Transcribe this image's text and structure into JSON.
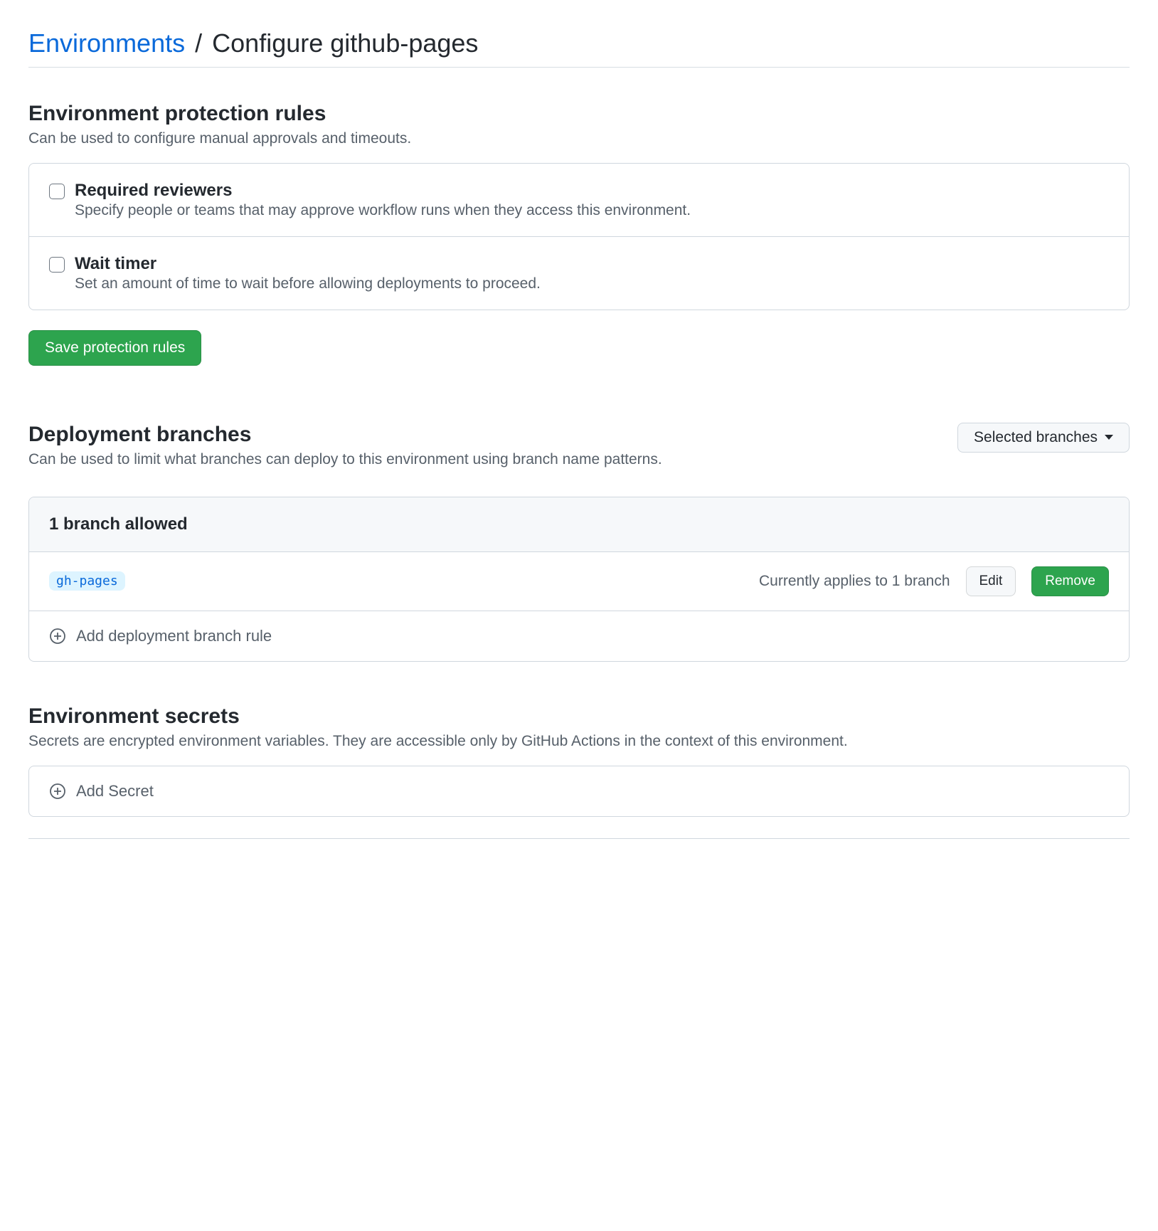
{
  "breadcrumb": {
    "root": "Environments",
    "current": "Configure github-pages"
  },
  "protection": {
    "title": "Environment protection rules",
    "desc": "Can be used to configure manual approvals and timeouts.",
    "rules": {
      "required_reviewers": {
        "label": "Required reviewers",
        "desc": "Specify people or teams that may approve workflow runs when they access this environment.",
        "checked": false
      },
      "wait_timer": {
        "label": "Wait timer",
        "desc": "Set an amount of time to wait before allowing deployments to proceed.",
        "checked": false
      }
    },
    "save_button": "Save protection rules"
  },
  "deployment": {
    "title": "Deployment branches",
    "desc": "Can be used to limit what branches can deploy to this environment using branch name patterns.",
    "selector_label": "Selected branches",
    "allowed_header": "1 branch allowed",
    "branch": {
      "name": "gh-pages",
      "applies": "Currently applies to 1 branch",
      "edit": "Edit",
      "remove": "Remove"
    },
    "add_rule": "Add deployment branch rule"
  },
  "secrets": {
    "title": "Environment secrets",
    "desc": "Secrets are encrypted environment variables. They are accessible only by GitHub Actions in the context of this environment.",
    "add": "Add Secret"
  }
}
